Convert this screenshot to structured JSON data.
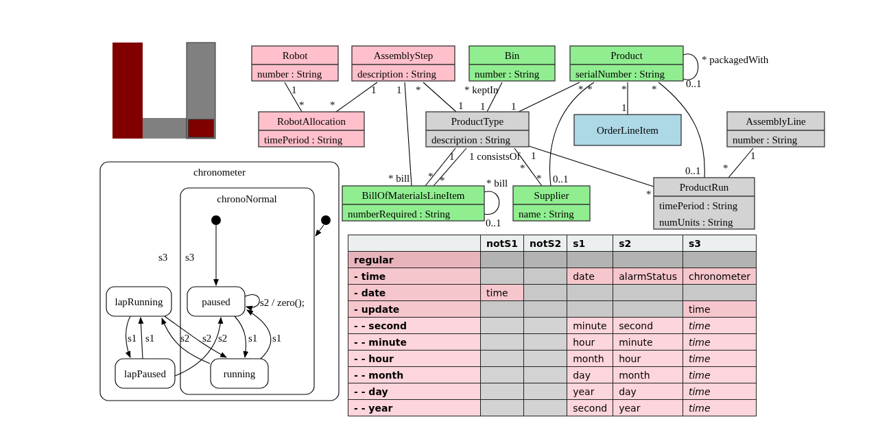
{
  "class_diagram": {
    "classes": [
      {
        "name": "Robot",
        "attributes": [
          "number : String"
        ],
        "color": "#ffc0cb"
      },
      {
        "name": "AssemblyStep",
        "attributes": [
          "description : String"
        ],
        "color": "#ffc0cb"
      },
      {
        "name": "Bin",
        "attributes": [
          "number : String"
        ],
        "color": "#90ee90"
      },
      {
        "name": "Product",
        "attributes": [
          "serialNumber : String"
        ],
        "color": "#90ee90"
      },
      {
        "name": "RobotAllocation",
        "attributes": [
          "timePeriod : String"
        ],
        "color": "#ffc0cb"
      },
      {
        "name": "ProductType",
        "attributes": [
          "description : String"
        ],
        "color": "#d3d3d3"
      },
      {
        "name": "OrderLineItem",
        "color": "#add8e6"
      },
      {
        "name": "AssemblyLine",
        "attributes": [
          "number : String"
        ],
        "color": "#d3d3d3"
      },
      {
        "name": "BillOfMaterialsLineItem",
        "attributes": [
          "numberRequired : String"
        ],
        "color": "#90ee90"
      },
      {
        "name": "Supplier",
        "attributes": [
          "name : String"
        ],
        "color": "#90ee90"
      },
      {
        "name": "ProductRun",
        "attributes": [
          "timePeriod : String",
          "numUnits : String"
        ],
        "color": "#d3d3d3"
      }
    ],
    "associations": [
      {
        "ends": [
          "1",
          "*"
        ]
      },
      {
        "ends": [
          "1",
          "*"
        ]
      },
      {
        "ends": [
          "1",
          "* bill"
        ]
      },
      {
        "ends": [
          "*",
          "1"
        ]
      },
      {
        "ends": [
          "* keptIn",
          "1"
        ]
      },
      {
        "ends": [
          "*",
          "1"
        ]
      },
      {
        "ends": [
          "1",
          "*"
        ]
      },
      {
        "ends": [
          "1 consistsOf",
          "*"
        ]
      },
      {
        "ends": [
          "*",
          "*"
        ]
      },
      {
        "ends": [
          "1",
          "*"
        ]
      },
      {
        "ends": [
          "*",
          "0..1"
        ]
      },
      {
        "ends": [
          "*",
          "1"
        ]
      },
      {
        "ends": [
          "*",
          "0..1"
        ]
      },
      {
        "ends": [
          "1",
          "*"
        ]
      },
      {
        "ends": [
          "* packagedWith",
          "0..1"
        ]
      },
      {
        "ends": [
          "* bill",
          "0..1"
        ]
      }
    ]
  },
  "state_diagram": {
    "title": "chronometer",
    "region": {
      "title": "chronoNormal"
    },
    "states": [
      {
        "name": "lapRunning"
      },
      {
        "name": "paused"
      },
      {
        "name": "lapPaused"
      },
      {
        "name": "running"
      }
    ],
    "transition_labels": [
      "s3",
      "s3",
      "s2 / zero();",
      "s1",
      "s1",
      "s2",
      "s2",
      "s2",
      "s1",
      "s1"
    ]
  },
  "table": {
    "columns": [
      "notS1",
      "notS2",
      "s1",
      "s2",
      "s3"
    ],
    "rows": [
      {
        "label": "regular",
        "kind": "group",
        "cells": [
          {
            "kind": "empty"
          },
          {
            "kind": "empty"
          },
          {
            "kind": "empty"
          },
          {
            "kind": "empty"
          },
          {
            "kind": "empty"
          }
        ]
      },
      {
        "label": "- time",
        "kind": "event",
        "cells": [
          {
            "kind": "empty"
          },
          {
            "kind": "empty"
          },
          {
            "kind": "value",
            "text": "date"
          },
          {
            "kind": "value",
            "text": "alarmStatus"
          },
          {
            "kind": "value",
            "text": "chronometer"
          }
        ]
      },
      {
        "label": "- date",
        "kind": "event",
        "cells": [
          {
            "kind": "value",
            "text": "time"
          },
          {
            "kind": "empty"
          },
          {
            "kind": "empty"
          },
          {
            "kind": "empty"
          },
          {
            "kind": "empty"
          }
        ]
      },
      {
        "label": "- update",
        "kind": "event",
        "cells": [
          {
            "kind": "empty"
          },
          {
            "kind": "empty"
          },
          {
            "kind": "empty"
          },
          {
            "kind": "empty"
          },
          {
            "kind": "value",
            "text": "time"
          }
        ]
      },
      {
        "label": "- - second",
        "kind": "sub_event",
        "cells": [
          {
            "kind": "empty"
          },
          {
            "kind": "empty"
          },
          {
            "kind": "value",
            "text": "minute"
          },
          {
            "kind": "value",
            "text": "second"
          },
          {
            "kind": "inherited",
            "text": "time"
          }
        ]
      },
      {
        "label": "- - minute",
        "kind": "sub_event",
        "cells": [
          {
            "kind": "empty"
          },
          {
            "kind": "empty"
          },
          {
            "kind": "value",
            "text": "hour"
          },
          {
            "kind": "value",
            "text": "minute"
          },
          {
            "kind": "inherited",
            "text": "time"
          }
        ]
      },
      {
        "label": "- - hour",
        "kind": "sub_event",
        "cells": [
          {
            "kind": "empty"
          },
          {
            "kind": "empty"
          },
          {
            "kind": "value",
            "text": "month"
          },
          {
            "kind": "value",
            "text": "hour"
          },
          {
            "kind": "inherited",
            "text": "time"
          }
        ]
      },
      {
        "label": "- - month",
        "kind": "sub_event",
        "cells": [
          {
            "kind": "empty"
          },
          {
            "kind": "empty"
          },
          {
            "kind": "value",
            "text": "day"
          },
          {
            "kind": "value",
            "text": "month"
          },
          {
            "kind": "inherited",
            "text": "time"
          }
        ]
      },
      {
        "label": "- - day",
        "kind": "sub_event",
        "cells": [
          {
            "kind": "empty"
          },
          {
            "kind": "empty"
          },
          {
            "kind": "value",
            "text": "year"
          },
          {
            "kind": "value",
            "text": "day"
          },
          {
            "kind": "inherited",
            "text": "time"
          }
        ]
      },
      {
        "label": "- - year",
        "kind": "sub_event",
        "cells": [
          {
            "kind": "empty"
          },
          {
            "kind": "empty"
          },
          {
            "kind": "value",
            "text": "second"
          },
          {
            "kind": "value",
            "text": "year"
          },
          {
            "kind": "inherited",
            "text": "time"
          }
        ]
      }
    ]
  }
}
